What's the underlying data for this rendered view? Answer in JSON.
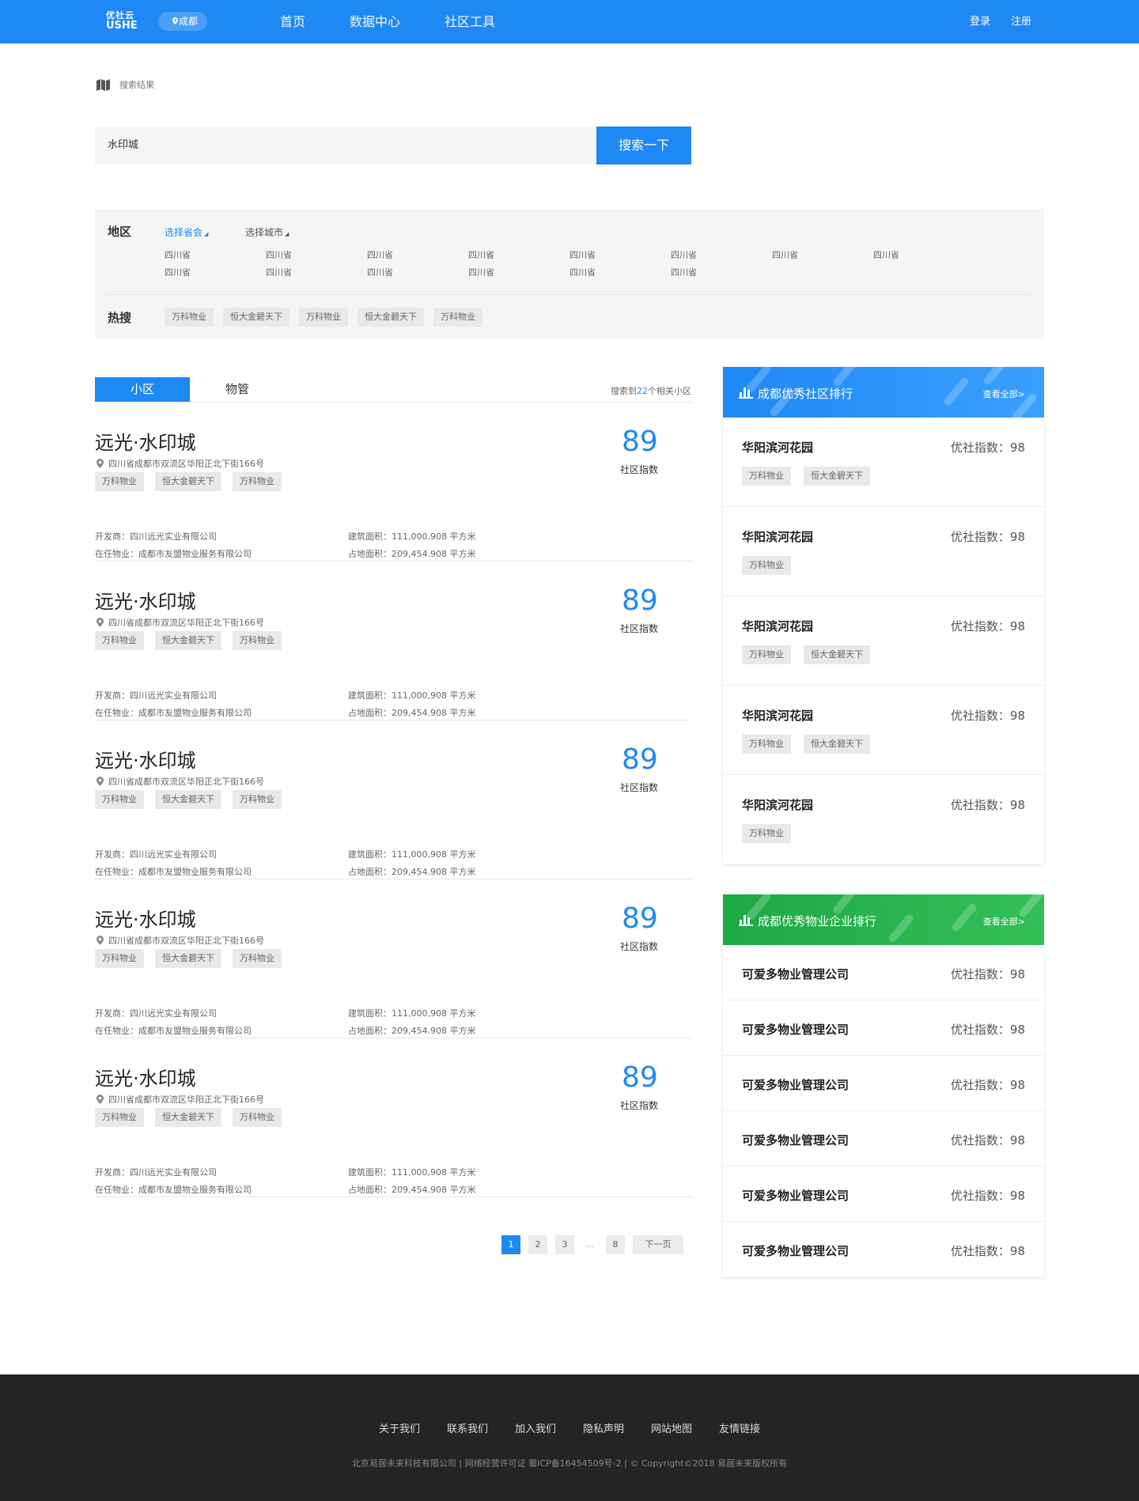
{
  "header": {
    "logo_cn": "优社云",
    "logo_en": "USHE",
    "city": "成都",
    "nav": [
      "首页",
      "数据中心",
      "社区工具"
    ],
    "login": "登录",
    "register": "注册"
  },
  "breadcrumb": "搜索结果",
  "search": {
    "value": "水印城",
    "button": "搜索一下"
  },
  "filter": {
    "region_label": "地区",
    "province_select": "选择省会",
    "city_select": "选择城市",
    "provinces": [
      "四川省",
      "四川省",
      "四川省",
      "四川省",
      "四川省",
      "四川省",
      "四川省",
      "四川省",
      "四川省",
      "四川省",
      "四川省",
      "四川省",
      "四川省",
      "四川省"
    ],
    "hot_label": "热搜",
    "hot_tags": [
      "万科物业",
      "恒大金碧天下",
      "万科物业",
      "恒大金碧天下",
      "万科物业"
    ]
  },
  "results": {
    "tab_active": "小区",
    "tab_other": "物管",
    "count_prefix": "搜索到",
    "count": "22",
    "count_suffix": "个相关小区",
    "score_label": "社区指数",
    "items": [
      {
        "name": "远光·水印城",
        "address": "四川省成都市双流区华阳正北下街166号",
        "tags": [
          "万科物业",
          "恒大金碧天下",
          "万科物业"
        ],
        "developer": "开发商：四川远光实业有限公司",
        "property": "在任物业：成都市友盟物业服务有限公司",
        "building_area": "建筑面积：111,000,908 平方米",
        "land_area": "占地面积：209,454.908 平方米",
        "score": "89"
      },
      {
        "name": "远光·水印城",
        "address": "四川省成都市双流区华阳正北下街166号",
        "tags": [
          "万科物业",
          "恒大金碧天下",
          "万科物业"
        ],
        "developer": "开发商：四川远光实业有限公司",
        "property": "在任物业：成都市友盟物业服务有限公司",
        "building_area": "建筑面积：111,000,908 平方米",
        "land_area": "占地面积：209,454.908 平方米",
        "score": "89"
      },
      {
        "name": "远光·水印城",
        "address": "四川省成都市双流区华阳正北下街166号",
        "tags": [
          "万科物业",
          "恒大金碧天下",
          "万科物业"
        ],
        "developer": "开发商：四川远光实业有限公司",
        "property": "在任物业：成都市友盟物业服务有限公司",
        "building_area": "建筑面积：111,000,908 平方米",
        "land_area": "占地面积：209,454.908 平方米",
        "score": "89"
      },
      {
        "name": "远光·水印城",
        "address": "四川省成都市双流区华阳正北下街166号",
        "tags": [
          "万科物业",
          "恒大金碧天下",
          "万科物业"
        ],
        "developer": "开发商：四川远光实业有限公司",
        "property": "在任物业：成都市友盟物业服务有限公司",
        "building_area": "建筑面积：111,000,908 平方米",
        "land_area": "占地面积：209,454.908 平方米",
        "score": "89"
      },
      {
        "name": "远光·水印城",
        "address": "四川省成都市双流区华阳正北下街166号",
        "tags": [
          "万科物业",
          "恒大金碧天下",
          "万科物业"
        ],
        "developer": "开发商：四川远光实业有限公司",
        "property": "在任物业：成都市友盟物业服务有限公司",
        "building_area": "建筑面积：111,000,908 平方米",
        "land_area": "占地面积：209,454.908 平方米",
        "score": "89"
      }
    ]
  },
  "pagination": {
    "pages": [
      "1",
      "2",
      "3"
    ],
    "ellipsis": "...",
    "last": "8",
    "next": "下一页"
  },
  "community_rank": {
    "title": "成都优秀社区排行",
    "more": "查看全部>",
    "rows": [
      {
        "name": "华阳滨河花园",
        "score": "优社指数：98",
        "tags": [
          "万科物业",
          "恒大金碧天下"
        ]
      },
      {
        "name": "华阳滨河花园",
        "score": "优社指数：98",
        "tags": [
          "万科物业"
        ]
      },
      {
        "name": "华阳滨河花园",
        "score": "优社指数：98",
        "tags": [
          "万科物业",
          "恒大金碧天下"
        ]
      },
      {
        "name": "华阳滨河花园",
        "score": "优社指数：98",
        "tags": [
          "万科物业",
          "恒大金碧天下"
        ]
      },
      {
        "name": "华阳滨河花园",
        "score": "优社指数：98",
        "tags": [
          "万科物业"
        ]
      }
    ]
  },
  "enterprise_rank": {
    "title": "成都优秀物业企业排行",
    "more": "查看全部>",
    "rows": [
      {
        "name": "可爱多物业管理公司",
        "score": "优社指数：98"
      },
      {
        "name": "可爱多物业管理公司",
        "score": "优社指数：98"
      },
      {
        "name": "可爱多物业管理公司",
        "score": "优社指数：98"
      },
      {
        "name": "可爱多物业管理公司",
        "score": "优社指数：98"
      },
      {
        "name": "可爱多物业管理公司",
        "score": "优社指数：98"
      },
      {
        "name": "可爱多物业管理公司",
        "score": "优社指数：98"
      }
    ]
  },
  "footer": {
    "links": [
      "关于我们",
      "联系我们",
      "加入我们",
      "隐私声明",
      "网站地图",
      "友情链接"
    ],
    "copyright": "北京易居未来科技有限公司 | 网络经营许可证 蜀ICP备16454509号-2 | © Copyright©2018 易居未来版权所有"
  },
  "colors": {
    "primary": "#1e88f5",
    "green": "#27ae4f",
    "footer_bg": "#242424"
  }
}
